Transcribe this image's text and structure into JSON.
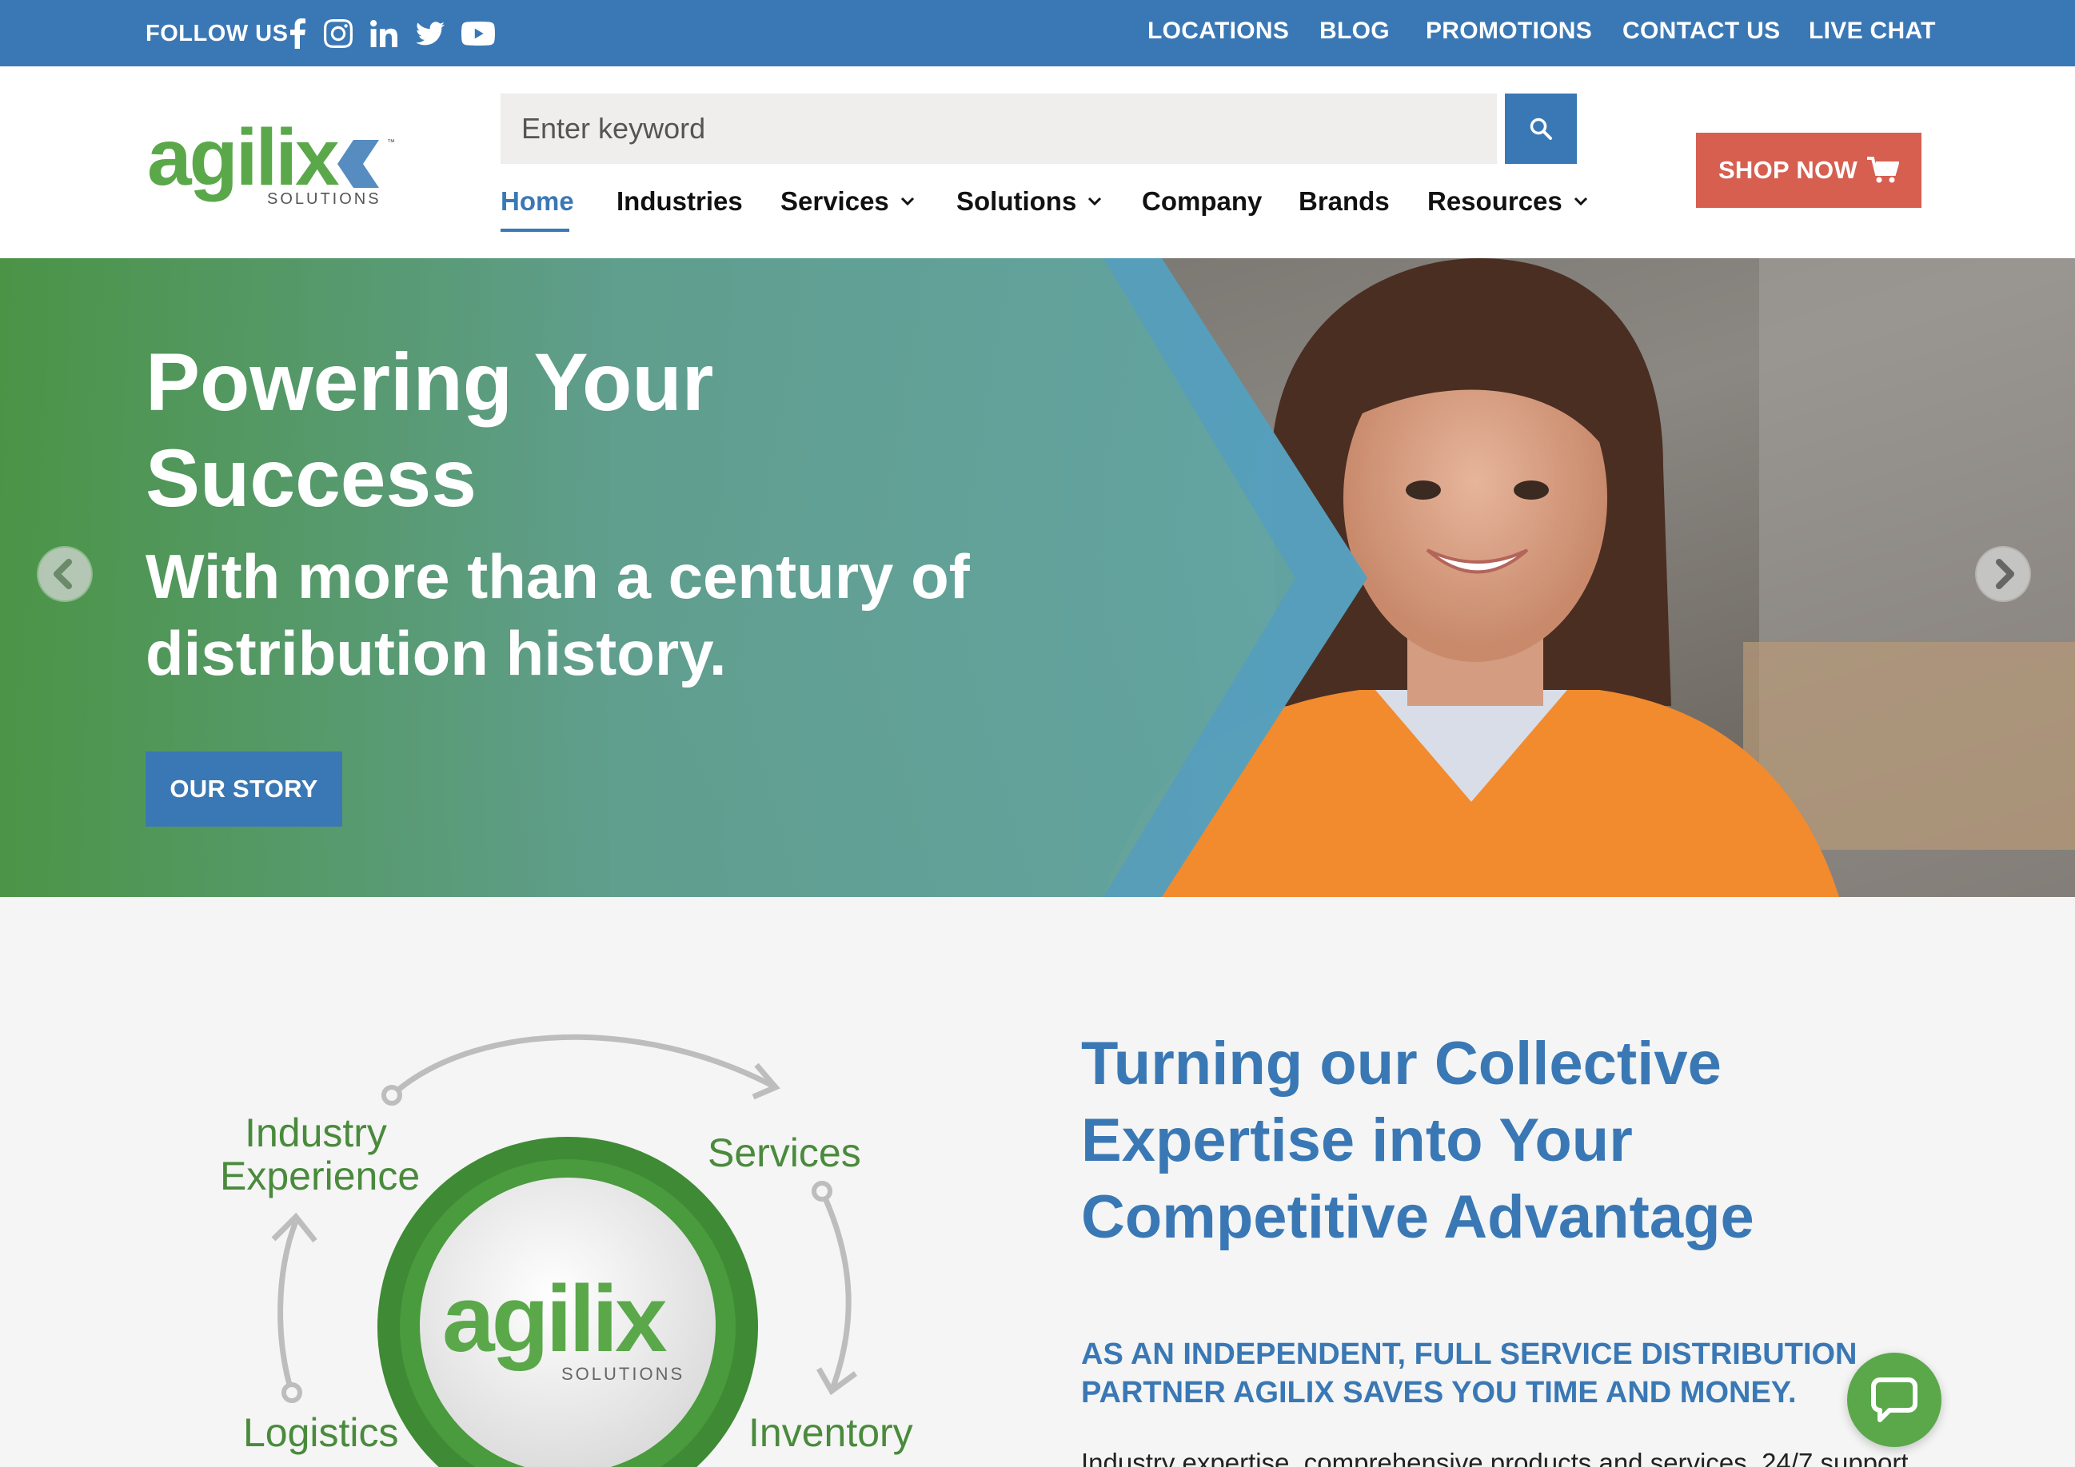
{
  "topbar": {
    "follow_label": "FOLLOW US",
    "social_icons": [
      "facebook-icon",
      "instagram-icon",
      "linkedin-icon",
      "twitter-icon",
      "youtube-icon"
    ],
    "links": [
      "LOCATIONS",
      "BLOG",
      "PROMOTIONS",
      "CONTACT US",
      "LIVE CHAT"
    ]
  },
  "header": {
    "logo_text": "agilix",
    "logo_sub": "SOLUTIONS",
    "logo_tm": "™",
    "search_placeholder": "Enter keyword",
    "shop_label": "SHOP NOW",
    "nav": [
      {
        "label": "Home",
        "active": true
      },
      {
        "label": "Industries"
      },
      {
        "label": "Services",
        "dropdown": true
      },
      {
        "label": "Solutions",
        "dropdown": true
      },
      {
        "label": "Company"
      },
      {
        "label": "Brands"
      },
      {
        "label": "Resources",
        "dropdown": true
      }
    ]
  },
  "hero": {
    "title": "Powering Your Success",
    "subtitle": "With more than a century of distribution history.",
    "button_label": "OUR STORY"
  },
  "diagram": {
    "labels": [
      "Industry Experience",
      "Services",
      "Logistics",
      "Inventory"
    ],
    "center_logo": "agilix",
    "center_sub": "SOLUTIONS"
  },
  "intro": {
    "title": "Turning our Collective Expertise into Your Competitive Advantage",
    "partner_text": "AS AN INDEPENDENT, FULL SERVICE DISTRIBUTION PARTNER AGILIX SAVES YOU TIME AND MONEY.",
    "body": "Industry expertise, comprehensive products and services, 24/7 support"
  },
  "colors": {
    "brand_blue": "#3a78b5",
    "brand_green": "#5aa84a",
    "shop_red": "#d65f50"
  }
}
